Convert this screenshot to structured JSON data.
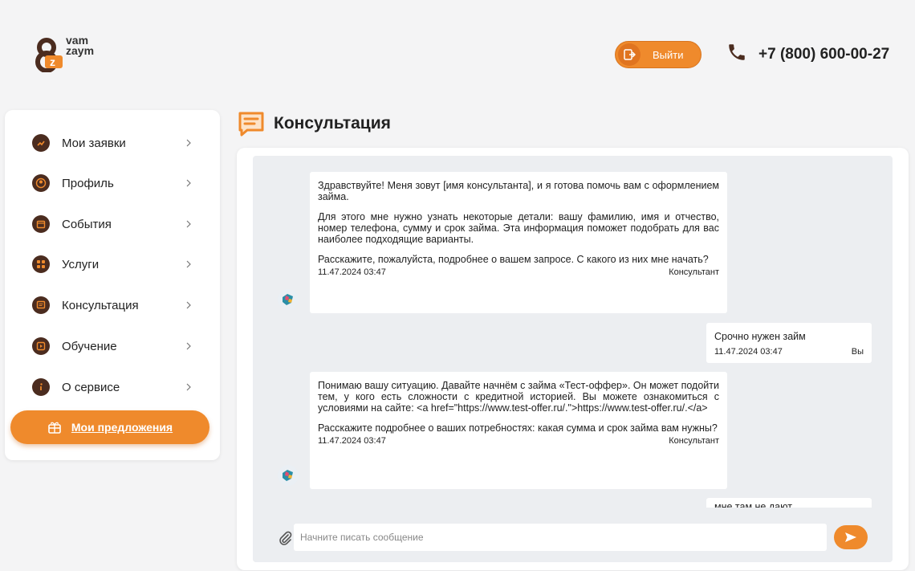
{
  "brand": {
    "logo_line1": "vam",
    "logo_line2": "zaym",
    "accent": "#ef8a2c",
    "icon_color": "#4b2c1f"
  },
  "header": {
    "logout_label": "Выйти",
    "phone": "+7 (800) 600-00-27"
  },
  "sidebar": {
    "items": [
      {
        "label": "Мои заявки",
        "icon": "applications-icon"
      },
      {
        "label": "Профиль",
        "icon": "profile-icon"
      },
      {
        "label": "События",
        "icon": "events-icon"
      },
      {
        "label": "Услуги",
        "icon": "services-icon"
      },
      {
        "label": "Консультация",
        "icon": "consultation-icon"
      },
      {
        "label": "Обучение",
        "icon": "education-icon"
      },
      {
        "label": "О сервисе",
        "icon": "info-icon"
      }
    ],
    "offers_label": "Мои предложения"
  },
  "page": {
    "title": "Консультация"
  },
  "chat": {
    "messages": [
      {
        "paragraphs": [
          "Здравствуйте! Меня зовут [имя консультанта], и я готова помочь вам с оформлением займа.",
          "Для этого мне нужно узнать некоторые детали: вашу фамилию, имя и отчество, номер телефона, сумму и срок займа. Эта информация поможет подобрать для вас наиболее подходящие варианты.",
          "Расскажите, пожалуйста, подробнее о вашем запросе. С какого из них мне начать?"
        ],
        "time": "11.47.2024 03:47",
        "author": "Консультант"
      },
      {
        "paragraphs": [
          "Срочно нужен займ"
        ],
        "time": "11.47.2024 03:47",
        "author": "Вы"
      },
      {
        "paragraphs": [
          "Понимаю вашу ситуацию. Давайте начнём с займа «Тест-оффер». Он может подойти тем, у кого есть сложности с кредитной историей. Вы можете ознакомиться с условиями на сайте: <a href=\"https://www.test-offer.ru/.\">https://www.test-offer.ru/.</a>",
          "Расскажите подробнее о ваших потребностях: какая сумма и срок займа вам нужны?"
        ],
        "time": "11.47.2024 03:47",
        "author": "Консультант"
      },
      {
        "paragraphs": [
          "мне там не дают"
        ]
      }
    ],
    "input_placeholder": "Начните писать сообщение"
  }
}
